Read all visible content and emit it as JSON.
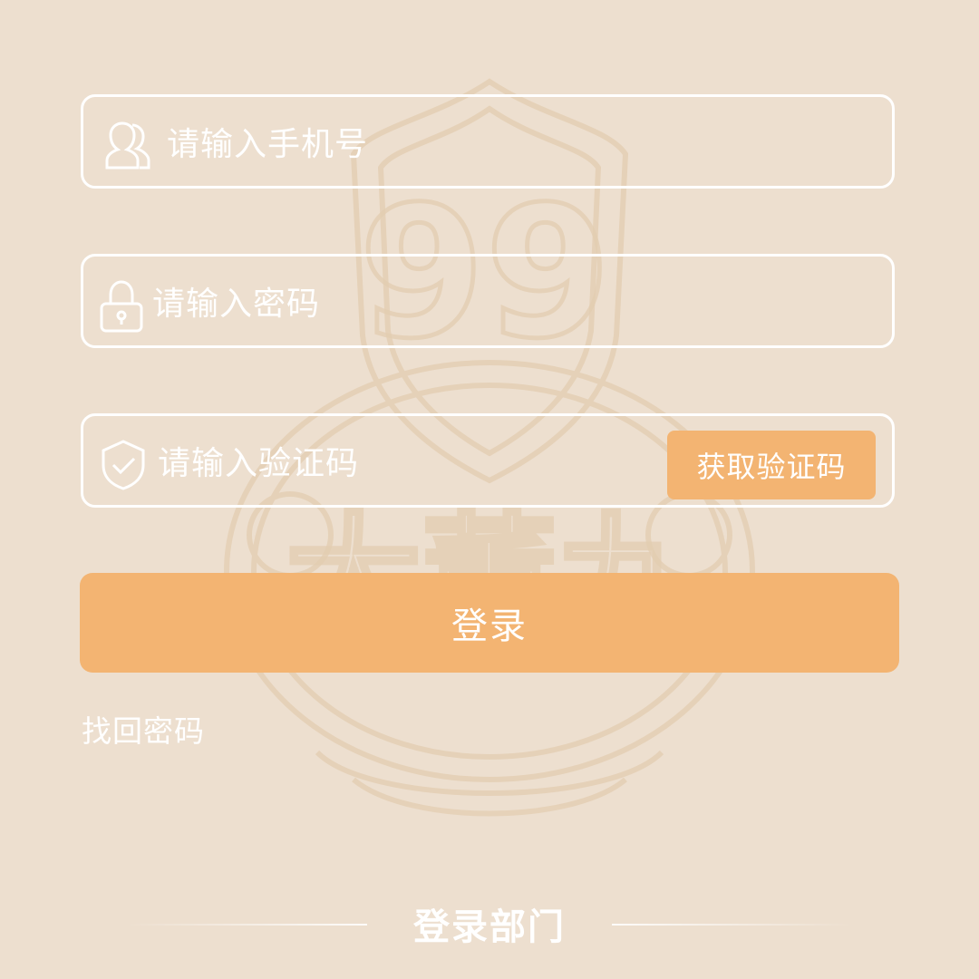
{
  "form": {
    "phone": {
      "placeholder": "请输入手机号",
      "icon": "users-icon"
    },
    "password": {
      "placeholder": "请输入密码",
      "icon": "lock-icon"
    },
    "code": {
      "placeholder": "请输入验证码",
      "icon": "shield-check-icon",
      "button_label": "获取验证码"
    },
    "login_label": "登录",
    "forgot_label": "找回密码"
  },
  "footer": {
    "title": "登录部门"
  },
  "watermark": {
    "text": "大董九",
    "emblem_text": "99"
  },
  "colors": {
    "background": "#eddfcf",
    "accent": "#f3b472",
    "foreground": "#ffffff"
  }
}
